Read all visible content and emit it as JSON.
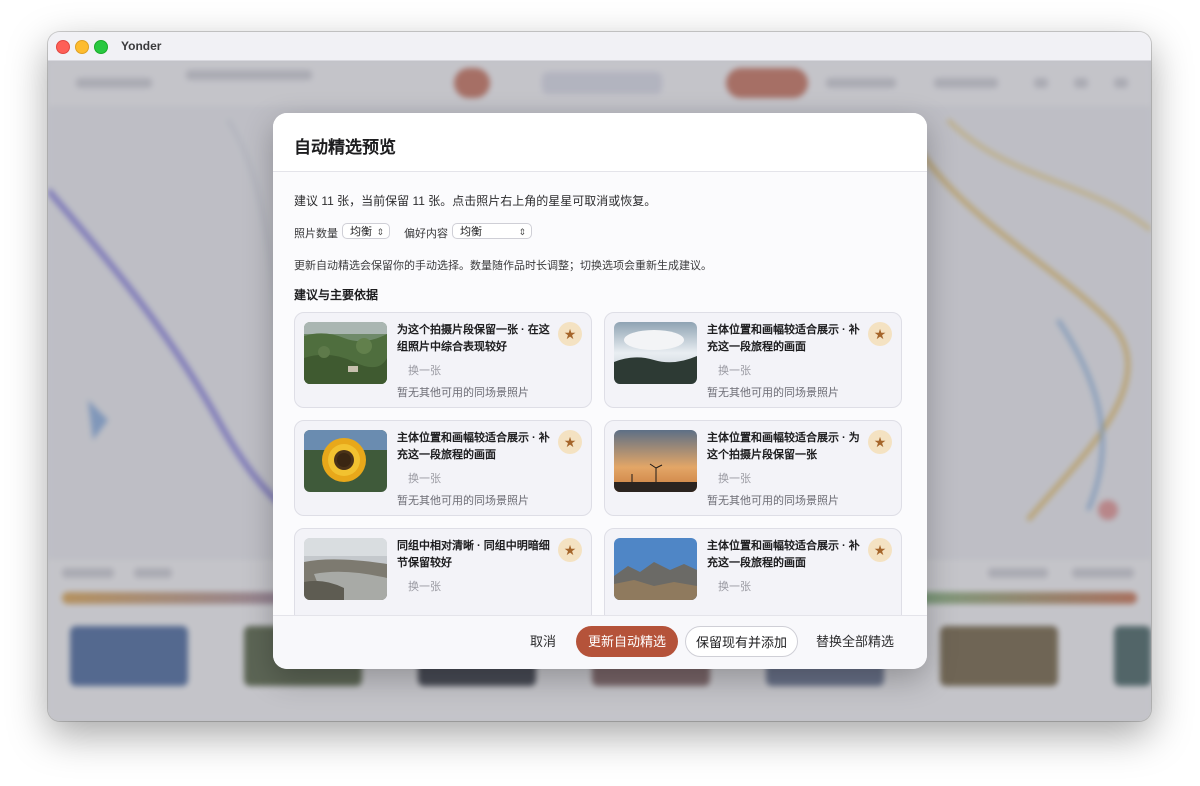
{
  "window": {
    "title": "Yonder"
  },
  "dialog": {
    "title": "自动精选预览",
    "summary": "建议 11 张，当前保留 11 张。点击照片右上角的星星可取消或恢复。",
    "photo_count_label": "照片数量",
    "photo_count_value": "均衡",
    "preference_label": "偏好内容",
    "preference_value": "均衡",
    "note": "更新自动精选会保留你的手动选择。数量随作品时长调整；切换选项会重新生成建议。",
    "section_title": "建议与主要依据",
    "cards": [
      {
        "reason": "为这个拍摄片段保留一张 · 在这组照片中综合表现较好",
        "swap": "换一张",
        "none": "暂无其他可用的同场景照片",
        "thumb": "aerial-karst-landscape",
        "starred": true
      },
      {
        "reason": "主体位置和画幅较适合展示 · 补充这一段旅程的画面",
        "swap": "换一张",
        "none": "暂无其他可用的同场景照片",
        "thumb": "cloudy-sky-over-hills",
        "starred": true
      },
      {
        "reason": "主体位置和画幅较适合展示 · 补充这一段旅程的画面",
        "swap": "换一张",
        "none": "暂无其他可用的同场景照片",
        "thumb": "sunflower",
        "starred": true
      },
      {
        "reason": "主体位置和画幅较适合展示 · 为这个拍摄片段保留一张",
        "swap": "换一张",
        "none": "暂无其他可用的同场景照片",
        "thumb": "wind-turbines-sunset",
        "starred": true
      },
      {
        "reason": "同组中相对清晰 · 同组中明暗细节保留较好",
        "swap": "换一张",
        "none": "",
        "thumb": "river-valley",
        "starred": true
      },
      {
        "reason": "主体位置和画幅较适合展示 · 补充这一段旅程的画面",
        "swap": "换一张",
        "none": "",
        "thumb": "mountains-blue-sky",
        "starred": true
      }
    ],
    "buttons": {
      "cancel": "取消",
      "refresh": "更新自动精选",
      "keep_add": "保留现有并添加",
      "replace_all": "替换全部精选"
    }
  },
  "colors": {
    "accent": "#b5533a",
    "star": "#a5652a",
    "star_bg": "#f4e2c2"
  }
}
